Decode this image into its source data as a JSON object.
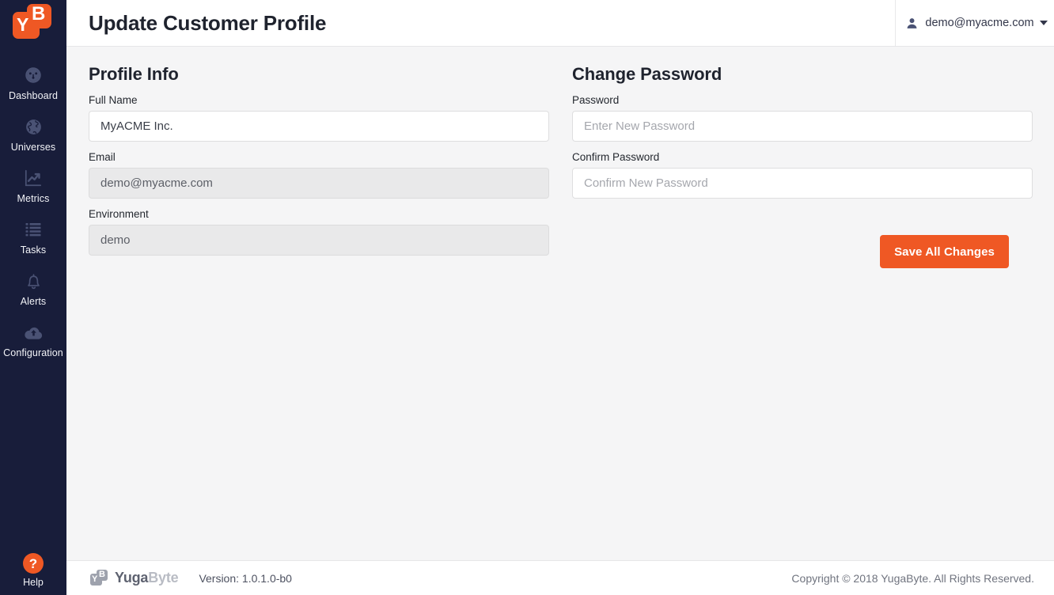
{
  "sidebar": {
    "logo": {
      "name": "yugabyte-logo",
      "letter_y": "Y",
      "letter_b": "B",
      "color": "#ef5824"
    },
    "items": [
      {
        "label": "Dashboard",
        "icon": "dashboard-gauge-icon"
      },
      {
        "label": "Universes",
        "icon": "globe-icon"
      },
      {
        "label": "Metrics",
        "icon": "chart-line-icon"
      },
      {
        "label": "Tasks",
        "icon": "list-icon"
      },
      {
        "label": "Alerts",
        "icon": "bell-icon"
      },
      {
        "label": "Configuration",
        "icon": "cloud-upload-icon"
      }
    ],
    "help": {
      "label": "Help",
      "icon": "question-mark-icon",
      "glyph": "?"
    },
    "background_color": "#181d3a",
    "icon_color": "#4a5274"
  },
  "header": {
    "title": "Update Customer Profile",
    "user_menu": {
      "email": "demo@myacme.com",
      "icon": "user-avatar-icon",
      "caret": "chevron-down-icon"
    }
  },
  "profile_info": {
    "section_title": "Profile Info",
    "fields": [
      {
        "label": "Full Name",
        "value": "MyACME Inc.",
        "placeholder": "",
        "disabled": false,
        "name": "full-name-input"
      },
      {
        "label": "Email",
        "value": "demo@myacme.com",
        "placeholder": "",
        "disabled": true,
        "name": "email-input"
      },
      {
        "label": "Environment",
        "value": "demo",
        "placeholder": "",
        "disabled": true,
        "name": "environment-input"
      }
    ]
  },
  "change_password": {
    "section_title": "Change Password",
    "fields": [
      {
        "label": "Password",
        "value": "",
        "placeholder": "Enter New Password",
        "disabled": false,
        "name": "password-input"
      },
      {
        "label": "Confirm Password",
        "value": "",
        "placeholder": "Confirm New Password",
        "disabled": false,
        "name": "confirm-password-input"
      }
    ]
  },
  "actions": {
    "save_label": "Save All Changes",
    "accent_color": "#ef5824"
  },
  "footer": {
    "brand_primary": "Yuga",
    "brand_secondary": "Byte",
    "version": "Version: 1.0.1.0-b0",
    "copyright": "Copyright © 2018 YugaByte. All Rights Reserved."
  }
}
